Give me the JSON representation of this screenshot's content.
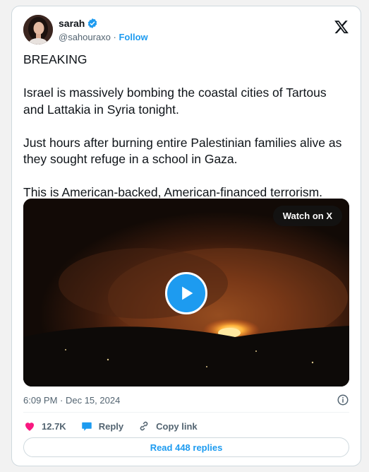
{
  "author": {
    "name": "sarah",
    "handle": "@sahouraxo",
    "separator": " · ",
    "follow_label": "Follow"
  },
  "post": {
    "paragraphs": [
      "BREAKING",
      "Israel is massively bombing the coastal cities of Tartous and Lattakia in Syria tonight.",
      "Just hours after burning entire Palestinian families alive as they sought refuge in a school in Gaza.",
      "This is American-backed, American-financed terrorism."
    ],
    "timestamp": "6:09 PM · Dec 15, 2024"
  },
  "media": {
    "watch_label": "Watch on X"
  },
  "actions": {
    "likes": "12.7K",
    "reply_label": "Reply",
    "copy_label": "Copy link"
  },
  "replies_button": "Read 448 replies",
  "colors": {
    "accent": "#1d9bf0",
    "like": "#f91880",
    "text": "#0f1419",
    "muted": "#536471"
  },
  "icons": [
    "verified-badge-icon",
    "x-logo-icon",
    "play-icon",
    "info-icon",
    "heart-icon",
    "reply-bubble-icon",
    "link-icon"
  ]
}
